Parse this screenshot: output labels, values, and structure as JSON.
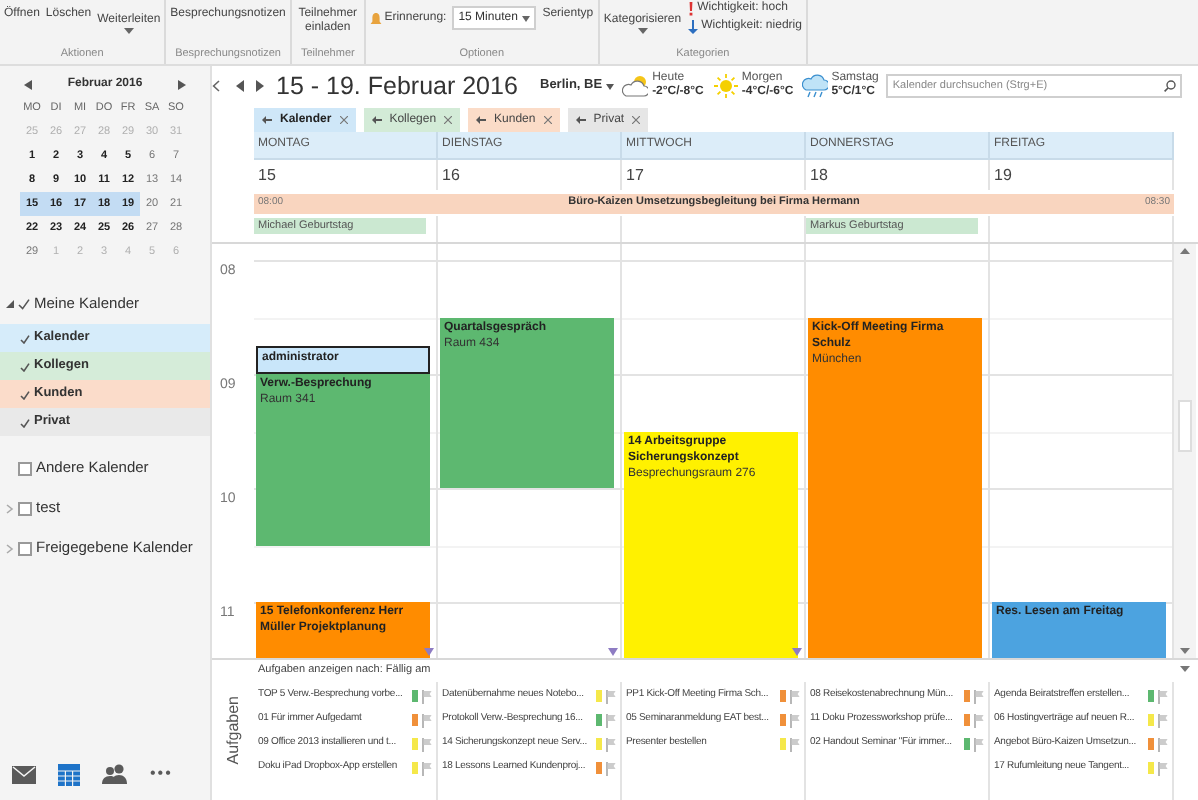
{
  "ribbon": {
    "groups": [
      {
        "label": "Aktionen",
        "buttons": [
          {
            "label": "Öffnen",
            "kind": "plain"
          },
          {
            "label": "Löschen",
            "kind": "plain"
          },
          {
            "label": "Weiterleiten",
            "kind": "dropdown"
          }
        ]
      },
      {
        "label": "Besprechungsnotizen",
        "buttons": [
          {
            "label": "Besprechungsnotizen",
            "kind": "plain"
          }
        ]
      },
      {
        "label": "Teilnehmer",
        "buttons": [
          {
            "label": "Teilnehmer einladen",
            "kind": "plain"
          }
        ]
      },
      {
        "label": "Optionen",
        "buttons": [
          {
            "label": "Erinnerung:",
            "kind": "bell"
          },
          {
            "label": "15 Minuten",
            "kind": "select"
          },
          {
            "label": "Serientyp",
            "kind": "plain"
          }
        ]
      },
      {
        "label": "Kategorien",
        "buttons": [
          {
            "label": "Kategorisieren",
            "kind": "dropdown"
          },
          {
            "label": "Wichtigkeit: hoch",
            "kind": "high"
          },
          {
            "label": "Wichtigkeit: niedrig",
            "kind": "low"
          }
        ]
      }
    ]
  },
  "mini_calendar": {
    "month": "Februar 2016",
    "weekdays": [
      "MO",
      "DI",
      "MI",
      "DO",
      "FR",
      "SA",
      "SO"
    ],
    "weeks": [
      [
        {
          "day": "25",
          "kind": "other",
          "selected": false
        },
        {
          "day": "26",
          "kind": "other",
          "selected": false
        },
        {
          "day": "27",
          "kind": "other",
          "selected": false
        },
        {
          "day": "28",
          "kind": "other",
          "selected": false
        },
        {
          "day": "29",
          "kind": "other",
          "selected": false
        },
        {
          "day": "30",
          "kind": "other",
          "selected": false
        },
        {
          "day": "31",
          "kind": "other",
          "selected": false
        }
      ],
      [
        {
          "day": "1",
          "kind": "bold",
          "selected": false
        },
        {
          "day": "2",
          "kind": "bold",
          "selected": false
        },
        {
          "day": "3",
          "kind": "bold",
          "selected": false
        },
        {
          "day": "4",
          "kind": "bold",
          "selected": false
        },
        {
          "day": "5",
          "kind": "bold",
          "selected": false
        },
        {
          "day": "6",
          "kind": "plain",
          "selected": false
        },
        {
          "day": "7",
          "kind": "plain",
          "selected": false
        }
      ],
      [
        {
          "day": "8",
          "kind": "bold",
          "selected": false
        },
        {
          "day": "9",
          "kind": "bold",
          "selected": false
        },
        {
          "day": "10",
          "kind": "bold",
          "selected": false
        },
        {
          "day": "11",
          "kind": "bold",
          "selected": false
        },
        {
          "day": "12",
          "kind": "bold",
          "selected": false
        },
        {
          "day": "13",
          "kind": "plain",
          "selected": false
        },
        {
          "day": "14",
          "kind": "plain",
          "selected": false
        }
      ],
      [
        {
          "day": "15",
          "kind": "bold",
          "selected": true
        },
        {
          "day": "16",
          "kind": "bold",
          "selected": true
        },
        {
          "day": "17",
          "kind": "bold",
          "selected": true
        },
        {
          "day": "18",
          "kind": "bold",
          "selected": true
        },
        {
          "day": "19",
          "kind": "bold",
          "selected": true
        },
        {
          "day": "20",
          "kind": "plain",
          "selected": false
        },
        {
          "day": "21",
          "kind": "plain",
          "selected": false
        }
      ],
      [
        {
          "day": "22",
          "kind": "bold",
          "selected": false
        },
        {
          "day": "23",
          "kind": "bold",
          "selected": false
        },
        {
          "day": "24",
          "kind": "bold",
          "selected": false
        },
        {
          "day": "25",
          "kind": "bold",
          "selected": false
        },
        {
          "day": "26",
          "kind": "bold",
          "selected": false
        },
        {
          "day": "27",
          "kind": "plain",
          "selected": false
        },
        {
          "day": "28",
          "kind": "plain",
          "selected": false
        }
      ],
      [
        {
          "day": "29",
          "kind": "plain",
          "selected": false
        },
        {
          "day": "1",
          "kind": "other",
          "selected": false
        },
        {
          "day": "2",
          "kind": "other",
          "selected": false
        },
        {
          "day": "3",
          "kind": "other",
          "selected": false
        },
        {
          "day": "4",
          "kind": "other",
          "selected": false
        },
        {
          "day": "5",
          "kind": "other",
          "selected": false
        },
        {
          "day": "6",
          "kind": "other",
          "selected": false
        }
      ]
    ]
  },
  "calendar_groups": [
    {
      "label": "Meine Kalender",
      "checked": true,
      "expanded": true,
      "children": [
        {
          "label": "Kalender",
          "checked": true,
          "color": "#d6ecfa"
        },
        {
          "label": "Kollegen",
          "checked": true,
          "color": "#d5ecd9"
        },
        {
          "label": "Kunden",
          "checked": true,
          "color": "#fbdcca"
        },
        {
          "label": "Privat",
          "checked": true,
          "color": "#e9e9e9"
        }
      ]
    },
    {
      "label": "Andere Kalender",
      "checked": false
    },
    {
      "label": "test",
      "checked": false,
      "expanded": false
    },
    {
      "label": "Freigegebene Kalender",
      "checked": false,
      "expanded": false
    }
  ],
  "nav": [
    {
      "kind": "mail",
      "selected": false
    },
    {
      "kind": "calendar",
      "selected": true
    },
    {
      "kind": "people",
      "selected": false
    },
    {
      "kind": "more",
      "label": "•••",
      "selected": false
    }
  ],
  "header": {
    "title": "15 - 19. Februar 2016",
    "location": "Berlin, BE",
    "weather": [
      {
        "day": "Heute",
        "temp": "-2°C/-8°C",
        "kind": "cloudy"
      },
      {
        "day": "Morgen",
        "temp": "-4°C/-6°C",
        "kind": "sunny"
      },
      {
        "day": "Samstag",
        "temp": "5°C/1°C",
        "kind": "showers"
      }
    ],
    "search": {
      "placeholder": "Kalender durchsuchen (Strg+E)"
    }
  },
  "tabs": [
    {
      "label": "Kalender",
      "color": "#cfe7f8",
      "selected": true
    },
    {
      "label": "Kollegen",
      "color": "#d3ebd7",
      "selected": false
    },
    {
      "label": "Kunden",
      "color": "#fbdcc8",
      "selected": false
    },
    {
      "label": "Privat",
      "color": "#e6e6e6",
      "selected": false
    }
  ],
  "all_day_event": {
    "start": "08:00",
    "title": "Büro-Kaizen Umsetzungsbegleitung bei Firma Hermann",
    "end": "08:30"
  },
  "hours": [
    "08",
    "09",
    "10",
    "11"
  ],
  "days": [
    {
      "name": "MONTAG",
      "date": "15",
      "birthday": "Michael Geburtstag",
      "more_below": true,
      "events": [
        {
          "title": "administrator",
          "color": "#c9e6fa",
          "selected": true
        },
        {
          "title": "Verw.-Besprechung",
          "subtitle": "Raum 341",
          "color": "#5db870",
          "selected": false
        },
        {
          "title": "15 Telefonkonferenz Herr Müller Projektplanung",
          "color": "#ff8c00",
          "selected": false
        }
      ]
    },
    {
      "name": "DIENSTAG",
      "date": "16",
      "more_below": true,
      "events": [
        {
          "title": "Quartalsgespräch",
          "subtitle": "Raum 434",
          "color": "#5db870",
          "selected": false
        }
      ]
    },
    {
      "name": "MITTWOCH",
      "date": "17",
      "more_below": true,
      "events": [
        {
          "title": "14 Arbeitsgruppe Sicherungskonzept",
          "subtitle": "Besprechungsraum 276",
          "color": "#fff100",
          "selected": false
        }
      ]
    },
    {
      "name": "DONNERSTAG",
      "date": "18",
      "birthday": "Markus Geburtstag",
      "events": [
        {
          "title": "Kick-Off Meeting Firma Schulz",
          "subtitle": "München",
          "color": "#ff8c00",
          "selected": false
        }
      ]
    },
    {
      "name": "FREITAG",
      "date": "19",
      "events": [
        {
          "title": "Res. Lesen am Freitag",
          "color": "#4ca3e0",
          "selected": false
        }
      ]
    }
  ],
  "tasks": {
    "side_label": "Aufgaben",
    "header": "Aufgaben anzeigen nach: Fällig am",
    "columns": [
      [
        {
          "text": "TOP 5 Verw.-Besprechung vorbe...",
          "color": "#5db870"
        },
        {
          "text": "01 Für immer Aufgedamt",
          "color": "#f0903a"
        },
        {
          "text": "09 Office 2013 installieren und t...",
          "color": "#f5e84a"
        },
        {
          "text": "Doku iPad Dropbox-App erstellen",
          "color": "#f5e84a"
        }
      ],
      [
        {
          "text": "Datenübernahme neues Notebo...",
          "color": "#f5e84a"
        },
        {
          "text": "Protokoll Verw.-Besprechung 16...",
          "color": "#5db870"
        },
        {
          "text": "14 Sicherungskonzept neue Serv...",
          "color": "#f5e84a"
        },
        {
          "text": "18 Lessons Learned Kundenproj...",
          "color": "#f0903a"
        }
      ],
      [
        {
          "text": "PP1 Kick-Off Meeting Firma Sch...",
          "color": "#f0903a"
        },
        {
          "text": "05 Seminaranmeldung EAT best...",
          "color": "#f0903a"
        },
        {
          "text": "Presenter bestellen",
          "color": "#f5e84a"
        }
      ],
      [
        {
          "text": "08 Reisekostenabrechnung Mün...",
          "color": "#f0903a"
        },
        {
          "text": "11 Doku Prozessworkshop prüfe...",
          "color": "#f0903a"
        },
        {
          "text": "02 Handout Seminar \"Für immer...",
          "color": "#5db870"
        }
      ],
      [
        {
          "text": "Agenda Beiratstreffen erstellen...",
          "color": "#5db870"
        },
        {
          "text": "06 Hostingverträge auf neuen R...",
          "color": "#f5e84a"
        },
        {
          "text": "Angebot Büro-Kaizen Umsetzun...",
          "color": "#f0903a"
        },
        {
          "text": "17 Rufumleitung neue Tangent...",
          "color": "#f5e84a"
        }
      ]
    ]
  }
}
